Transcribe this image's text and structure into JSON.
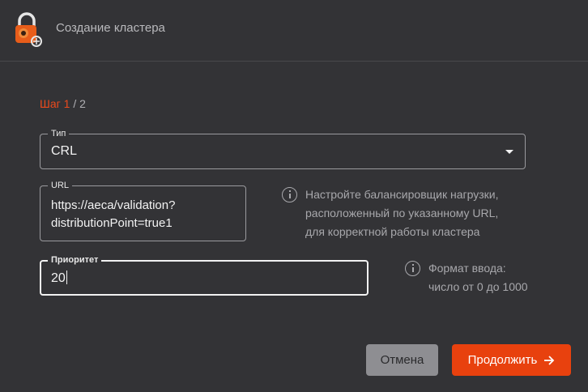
{
  "header": {
    "title": "Создание кластера",
    "logo_icon": "padlock-logo-icon"
  },
  "step": {
    "label": "Шаг",
    "current": "1",
    "separator": "/",
    "total": "2"
  },
  "fields": {
    "type": {
      "label": "Тип",
      "value": "CRL"
    },
    "url": {
      "label": "URL",
      "value": "https://aeca/validation?\ndistributionPoint=true1"
    },
    "priority": {
      "label": "Приоритет",
      "value": "20"
    }
  },
  "hints": {
    "url": "Настройте балансировщик нагрузки,\nрасположенный по указанному URL,\nдля корректной работы кластера",
    "priority": "Формат ввода:\nчисло от 0 до 1000"
  },
  "buttons": {
    "cancel": "Отмена",
    "next": "Продолжить",
    "next_icon": "arrow-right-icon"
  },
  "colors": {
    "accent": "#e8410e",
    "background": "#333336"
  }
}
